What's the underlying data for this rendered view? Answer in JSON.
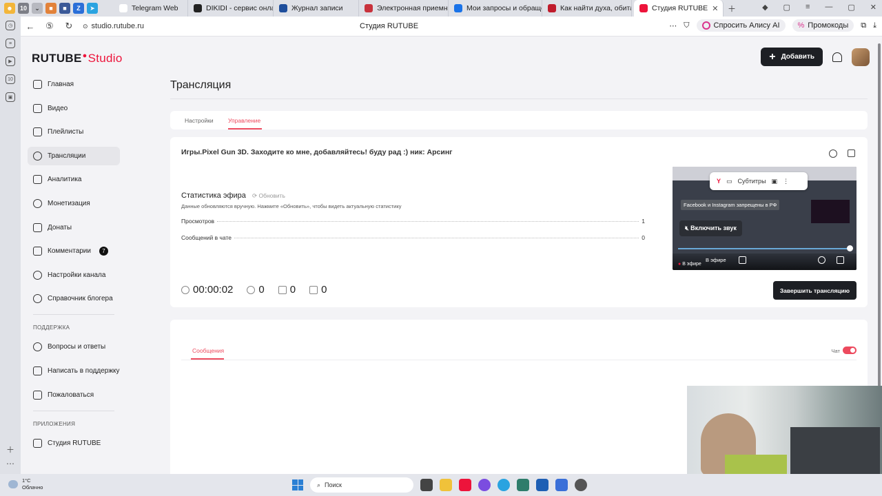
{
  "browser": {
    "tab_count": "10",
    "tabs": [
      {
        "label": "Telegram Web",
        "color": "#2aa3e0"
      },
      {
        "label": "DIKIDI - сервис онлайн за",
        "color": "#222"
      },
      {
        "label": "Журнал записи",
        "color": "#1e4e9c"
      },
      {
        "label": "Электронная приемная",
        "color": "#c8323c"
      },
      {
        "label": "Мои запросы и обращен",
        "color": "#1a73e8"
      },
      {
        "label": "Как найти духа, обитаю",
        "color": "#c01c2c"
      },
      {
        "label": "Студия RUTUBE",
        "color": "#ed143b",
        "active": true
      }
    ],
    "url": "studio.rutube.ru",
    "page_title": "Студия RUTUBE",
    "alice_label": "Спросить Алису AI",
    "promo_label": "Промокоды"
  },
  "logo": {
    "brand": "RUTUBE",
    "suffix": "Studio"
  },
  "header": {
    "add_label": "Добавить"
  },
  "sidebar": {
    "items": [
      {
        "label": "Главная"
      },
      {
        "label": "Видео"
      },
      {
        "label": "Плейлисты"
      },
      {
        "label": "Трансляции",
        "active": true
      },
      {
        "label": "Аналитика"
      },
      {
        "label": "Монетизация"
      },
      {
        "label": "Донаты"
      },
      {
        "label": "Комментарии",
        "badge": "7"
      },
      {
        "label": "Настройки канала"
      },
      {
        "label": "Справочник блогера"
      }
    ],
    "support_heading": "ПОДДЕРЖКА",
    "support_items": [
      {
        "label": "Вопросы и ответы"
      },
      {
        "label": "Написать в поддержку"
      },
      {
        "label": "Пожаловаться"
      }
    ],
    "apps_heading": "ПРИЛОЖЕНИЯ",
    "apps_items": [
      {
        "label": "Студия RUTUBE"
      }
    ]
  },
  "main": {
    "page_title": "Трансляция",
    "tabs": [
      {
        "label": "Настройки"
      },
      {
        "label": "Управление",
        "active": true
      }
    ],
    "stream_title": "Игры.Pixel Gun 3D. Заходите ко мне, добавляйтесь! буду рад :) ник: Арсинг",
    "stats_title": "Статистика эфира",
    "refresh_label": "Обновить",
    "stats_note": "Данные обновляются вручную. Нажмите «Обновить», чтобы видеть актуальную статистику",
    "stats": [
      {
        "label": "Просмотров",
        "value": "1"
      },
      {
        "label": "Сообщений в чате",
        "value": "0"
      }
    ],
    "counters": {
      "duration": "00:00:02",
      "viewers": "0",
      "likes": "0",
      "dislikes": "0"
    },
    "preview": {
      "subtitles_label": "Субтитры",
      "warning": "Facebook и Instagram запрещены в РФ",
      "sound_label": "Включить звук",
      "live_label": "В эфире",
      "live_label_2": "В эфире"
    },
    "end_label": "Завершить трансляцию",
    "chat": {
      "messages_tab": "Сообщения",
      "chat_label": "Чат"
    }
  },
  "taskbar": {
    "temperature": "1°C",
    "weather_text": "Облачно",
    "search_label": "Поиск"
  },
  "colors": {
    "accent": "#ed4a5e",
    "brand_red": "#ed143b",
    "dark_button": "#1d1f24"
  }
}
